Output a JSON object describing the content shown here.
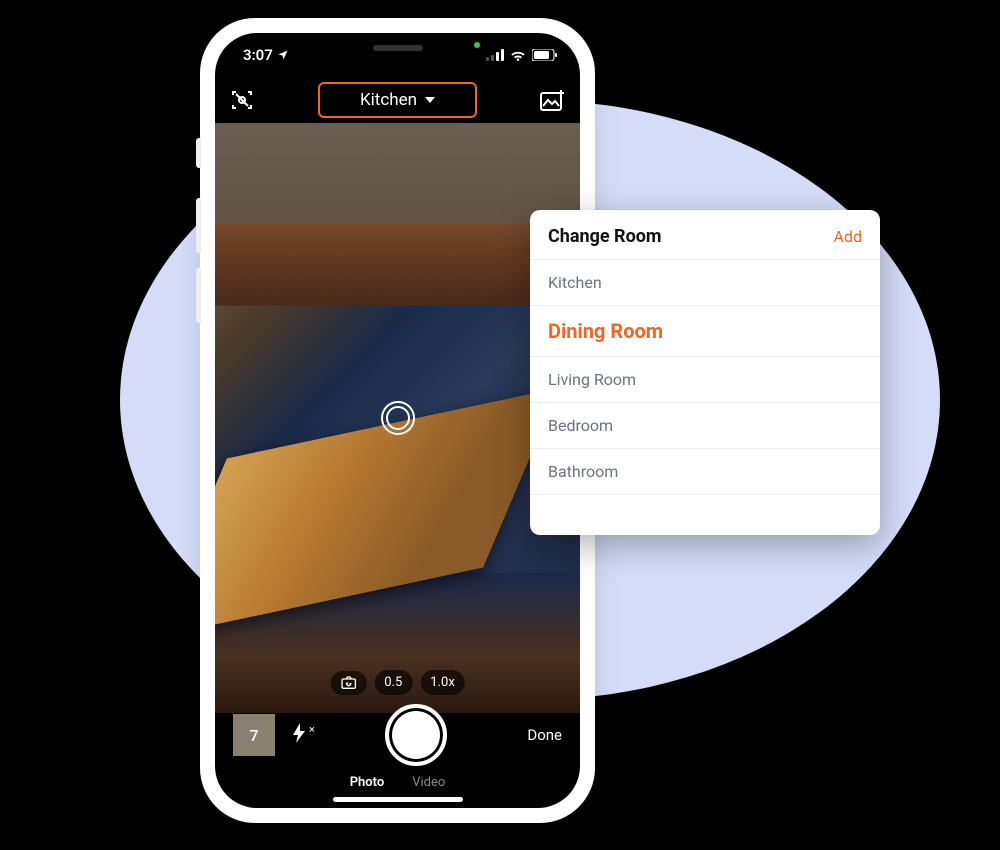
{
  "status": {
    "time": "3:07",
    "locationArrow": "➤"
  },
  "toolbar": {
    "roomLabel": "Kitchen"
  },
  "zoom": {
    "level1": "0.5",
    "level2": "1.0x"
  },
  "bottom": {
    "thumbCount": "7",
    "done": "Done"
  },
  "modes": {
    "photo": "Photo",
    "video": "Video"
  },
  "popover": {
    "title": "Change Room",
    "add": "Add",
    "items": [
      {
        "label": "Kitchen",
        "selected": false
      },
      {
        "label": "Dining Room",
        "selected": true
      },
      {
        "label": "Living Room",
        "selected": false
      },
      {
        "label": "Bedroom",
        "selected": false
      },
      {
        "label": "Bathroom",
        "selected": false
      }
    ]
  },
  "colors": {
    "accent": "#f26522",
    "bgEllipse": "#d4dcf8"
  }
}
